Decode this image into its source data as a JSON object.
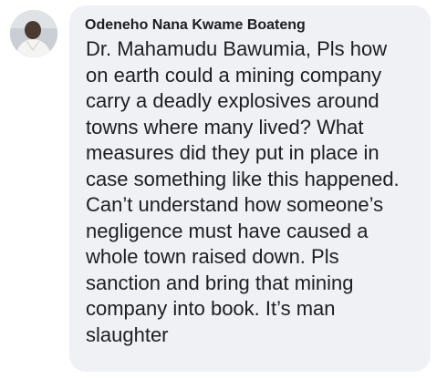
{
  "comment": {
    "author": "Odeneho Nana Kwame Boateng",
    "text": "Dr. Mahamudu Bawumia, Pls how\non earth could a mining company\ncarry a deadly explosives around\ntowns where many lived? What\nmeasures did they put in place in\ncase something like this happened.\nCan’t understand how someone’s\nnegligence must have caused a\nwhole town raised down. Pls\nsanction and bring that mining\ncompany into book. It’s man\nslaughter"
  },
  "colors": {
    "bubble_background": "#eff1f5",
    "text": "#1c1e21"
  }
}
